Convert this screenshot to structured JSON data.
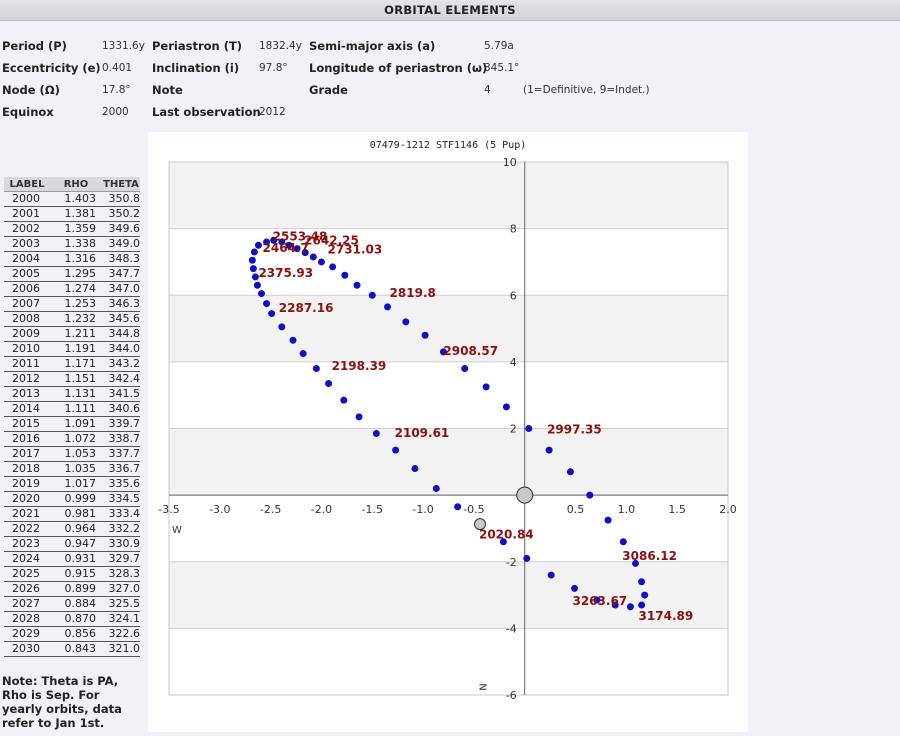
{
  "header": {
    "title": "ORBITAL ELEMENTS"
  },
  "elements": {
    "period_label": "Period (P)",
    "period_value": "1331.6y",
    "periastron_label": "Periastron (T)",
    "periastron_value": "1832.4y",
    "semimajor_label": "Semi-major axis (a)",
    "semimajor_value": "5.79a",
    "ecc_label": "Eccentricity (e)",
    "ecc_value": "0.401",
    "incl_label": "Inclination (i)",
    "incl_value": "97.8°",
    "omega_label": "Longitude of periastron (ω)",
    "omega_value": "345.1°",
    "node_label": "Node (Ω)",
    "node_value": "17.8°",
    "note_label": "Note",
    "grade_label": "Grade",
    "grade_value": "4",
    "grade_note": "(1=Definitive, 9=Indet.)",
    "equinox_label": "Equinox",
    "equinox_value": "2000",
    "lastobs_label": "Last observation",
    "lastobs_value": "2012"
  },
  "ephemeris": {
    "headers": [
      "LABEL",
      "RHO",
      "THETA"
    ],
    "rows": [
      [
        "2000",
        "1.403",
        "350.8"
      ],
      [
        "2001",
        "1.381",
        "350.2"
      ],
      [
        "2002",
        "1.359",
        "349.6"
      ],
      [
        "2003",
        "1.338",
        "349.0"
      ],
      [
        "2004",
        "1.316",
        "348.3"
      ],
      [
        "2005",
        "1.295",
        "347.7"
      ],
      [
        "2006",
        "1.274",
        "347.0"
      ],
      [
        "2007",
        "1.253",
        "346.3"
      ],
      [
        "2008",
        "1.232",
        "345.6"
      ],
      [
        "2009",
        "1.211",
        "344.8"
      ],
      [
        "2010",
        "1.191",
        "344.0"
      ],
      [
        "2011",
        "1.171",
        "343.2"
      ],
      [
        "2012",
        "1.151",
        "342.4"
      ],
      [
        "2013",
        "1.131",
        "341.5"
      ],
      [
        "2014",
        "1.111",
        "340.6"
      ],
      [
        "2015",
        "1.091",
        "339.7"
      ],
      [
        "2016",
        "1.072",
        "338.7"
      ],
      [
        "2017",
        "1.053",
        "337.7"
      ],
      [
        "2018",
        "1.035",
        "336.7"
      ],
      [
        "2019",
        "1.017",
        "335.6"
      ],
      [
        "2020",
        "0.999",
        "334.5"
      ],
      [
        "2021",
        "0.981",
        "333.4"
      ],
      [
        "2022",
        "0.964",
        "332.2"
      ],
      [
        "2023",
        "0.947",
        "330.9"
      ],
      [
        "2024",
        "0.931",
        "329.7"
      ],
      [
        "2025",
        "0.915",
        "328.3"
      ],
      [
        "2026",
        "0.899",
        "327.0"
      ],
      [
        "2027",
        "0.884",
        "325.5"
      ],
      [
        "2028",
        "0.870",
        "324.1"
      ],
      [
        "2029",
        "0.856",
        "322.6"
      ],
      [
        "2030",
        "0.843",
        "321.0"
      ]
    ],
    "note": "Note: Theta is PA, Rho is Sep. For yearly orbits, data refer to Jan 1st."
  },
  "chart_data": {
    "type": "scatter",
    "title": "07479-1212 STF1146 (5 Pup)",
    "xlim": [
      -3.5,
      2.0
    ],
    "ylim": [
      -6,
      10
    ],
    "x_ticks": [
      "-3.5",
      "-3.0",
      "-2.5",
      "-2.0",
      "-1.5",
      "-1.0",
      "-0.5",
      "0.5",
      "1.0",
      "1.5",
      "2.0"
    ],
    "y_ticks": [
      "10",
      "8",
      "6",
      "4",
      "2",
      "-2",
      "-4",
      "-6"
    ],
    "axis_letters": {
      "x": "W",
      "y": "N"
    },
    "grid_bands": true,
    "colors": {
      "points": "#0f0fc8",
      "labels": "#8b1010",
      "band": "#f2f2f2"
    },
    "orbit_points": [
      [
        0.04,
        2.0
      ],
      [
        0.24,
        1.35
      ],
      [
        0.45,
        0.7
      ],
      [
        0.64,
        0.0
      ],
      [
        0.82,
        -0.75
      ],
      [
        0.97,
        -1.4
      ],
      [
        1.09,
        -2.05
      ],
      [
        1.15,
        -2.6
      ],
      [
        1.18,
        -3.0
      ],
      [
        1.15,
        -3.3
      ],
      [
        1.04,
        -3.35
      ],
      [
        0.89,
        -3.3
      ],
      [
        0.71,
        -3.15
      ],
      [
        0.49,
        -2.8
      ],
      [
        0.26,
        -2.4
      ],
      [
        0.02,
        -1.9
      ],
      [
        -0.21,
        -1.4
      ],
      [
        -0.66,
        -0.35
      ],
      [
        -0.87,
        0.2
      ],
      [
        -1.08,
        0.8
      ],
      [
        -1.27,
        1.35
      ],
      [
        -1.46,
        1.85
      ],
      [
        -1.63,
        2.35
      ],
      [
        -1.78,
        2.85
      ],
      [
        -1.93,
        3.35
      ],
      [
        -2.05,
        3.8
      ],
      [
        -2.18,
        4.25
      ],
      [
        -2.28,
        4.65
      ],
      [
        -2.39,
        5.05
      ],
      [
        -2.49,
        5.45
      ],
      [
        -2.54,
        5.75
      ],
      [
        -2.59,
        6.05
      ],
      [
        -2.63,
        6.3
      ],
      [
        -2.65,
        6.55
      ],
      [
        -2.67,
        6.8
      ],
      [
        -2.68,
        7.05
      ],
      [
        -2.66,
        7.3
      ],
      [
        -2.62,
        7.5
      ],
      [
        -2.54,
        7.6
      ],
      [
        -2.47,
        7.65
      ],
      [
        -2.39,
        7.6
      ],
      [
        -2.32,
        7.5
      ],
      [
        -2.24,
        7.4
      ],
      [
        -2.16,
        7.28
      ],
      [
        -2.08,
        7.15
      ],
      [
        -2.0,
        7.0
      ],
      [
        -1.89,
        6.85
      ],
      [
        -1.77,
        6.6
      ],
      [
        -1.65,
        6.3
      ],
      [
        -1.5,
        6.0
      ],
      [
        -1.35,
        5.65
      ],
      [
        -1.17,
        5.2
      ],
      [
        -0.98,
        4.8
      ],
      [
        -0.8,
        4.3
      ],
      [
        -0.59,
        3.8
      ],
      [
        -0.38,
        3.25
      ],
      [
        -0.18,
        2.65
      ]
    ],
    "orbit_labels": [
      {
        "text": "2553.48",
        "x": -2.48,
        "y": 7.65
      },
      {
        "text": "2642.25",
        "x": -2.17,
        "y": 7.52
      },
      {
        "text": "2464.7",
        "x": -2.58,
        "y": 7.3
      },
      {
        "text": "2375.93",
        "x": -2.62,
        "y": 6.55
      },
      {
        "text": "2287.16",
        "x": -2.42,
        "y": 5.5
      },
      {
        "text": "2198.39",
        "x": -1.9,
        "y": 3.75
      },
      {
        "text": "2109.61",
        "x": -1.28,
        "y": 1.75
      },
      {
        "text": "2020.84",
        "x": -0.45,
        "y": -1.3
      },
      {
        "text": "2731.03",
        "x": -1.94,
        "y": 7.25
      },
      {
        "text": "2819.8",
        "x": -1.33,
        "y": 5.95
      },
      {
        "text": "2908.57",
        "x": -0.8,
        "y": 4.2
      },
      {
        "text": "2997.35",
        "x": 0.22,
        "y": 1.85
      },
      {
        "text": "3086.12",
        "x": 0.96,
        "y": -1.95
      },
      {
        "text": "3174.89",
        "x": 1.12,
        "y": -3.75
      },
      {
        "text": "3263.67",
        "x": 0.47,
        "y": -3.3
      }
    ],
    "primary": {
      "x": 0,
      "y": 0
    },
    "secondary": {
      "x": -0.44,
      "y": -0.87
    }
  }
}
